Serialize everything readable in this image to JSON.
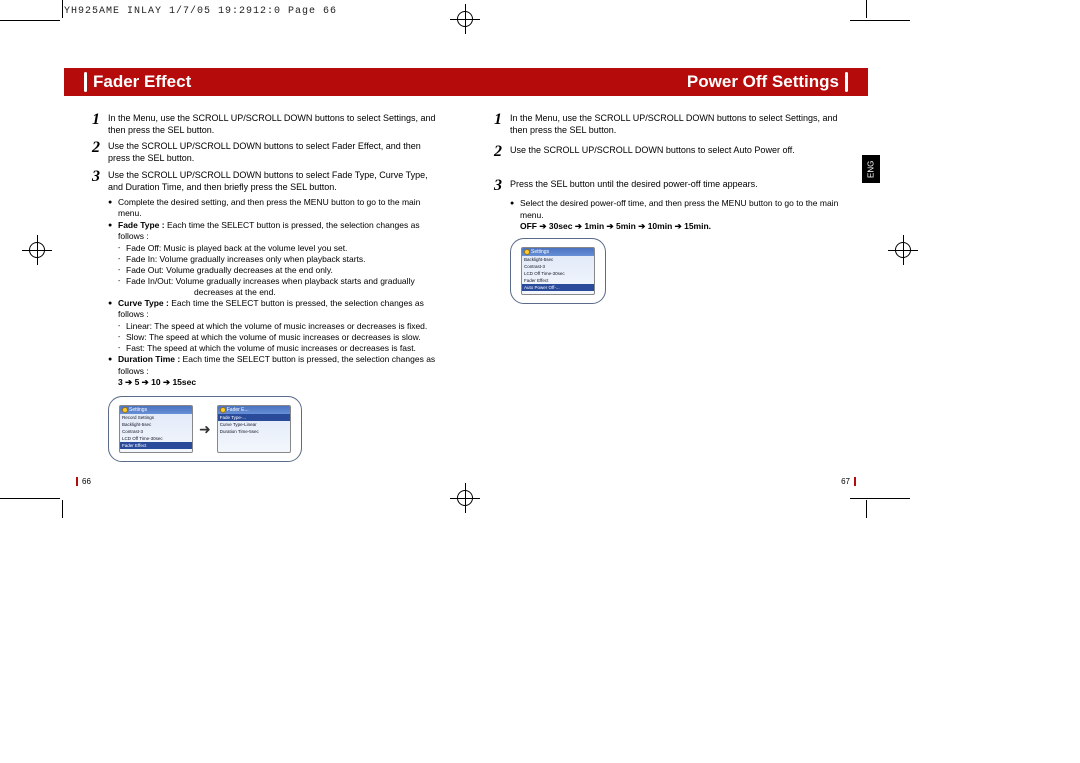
{
  "print_header": "YH925AME INLAY  1/7/05 19:2912:0  Page 66",
  "eng_tab": "ENG",
  "left": {
    "title": "Fader Effect",
    "page_num": "66",
    "steps": [
      {
        "num": "1",
        "text": "In the Menu, use the SCROLL UP/SCROLL DOWN buttons to select Settings, and then press the SEL button."
      },
      {
        "num": "2",
        "text": "Use the SCROLL UP/SCROLL DOWN buttons to select Fader Effect, and then press the SEL button."
      },
      {
        "num": "3",
        "text": "Use the SCROLL UP/SCROLL DOWN buttons to select Fade Type, Curve Type, and Duration Time, and then briefly press the SEL button."
      }
    ],
    "bullets": {
      "complete": "Complete the desired setting, and then press the MENU button to go to the main menu.",
      "fade_type_lead": "Fade Type : ",
      "fade_type_rest": "Each time the SELECT button is pressed, the selection changes as follows :",
      "fade_sub": [
        "Fade Off: Music is played back at the volume level you set.",
        "Fade In: Volume gradually increases only when playback starts.",
        "Fade Out: Volume gradually decreases at the end only.",
        "Fade In/Out: Volume gradually increases when playback starts and gradually"
      ],
      "fade_sub_cont": "decreases at the end.",
      "curve_lead": "Curve Type : ",
      "curve_rest": "Each time the SELECT button is pressed, the selection changes as follows :",
      "curve_sub": [
        "Linear: The speed at which the volume of music increases or decreases is fixed.",
        "Slow: The speed at which the volume of music increases or decreases is slow.",
        "Fast: The speed at which the volume of music increases or decreases is fast."
      ],
      "duration_lead": "Duration Time : ",
      "duration_rest": "Each time the SELECT button is pressed, the selection changes as follows :",
      "duration_seq": "3 ➔ 5 ➔ 10 ➔ 15sec"
    },
    "screens": {
      "settings": {
        "header": "Settings",
        "rows": [
          "Record Settings",
          "Backlight-5sec",
          "Contrast-3",
          "LCD Off Time-30sec"
        ],
        "selected": "Fader Effect"
      },
      "fader": {
        "header": "Fader E...",
        "selected": "Fade Type-...",
        "rows": [
          "Curve Type-Linear",
          "Duration Time-5sec"
        ]
      }
    }
  },
  "right": {
    "title": "Power Off Settings",
    "page_num": "67",
    "steps": [
      {
        "num": "1",
        "text": "In the Menu, use the SCROLL UP/SCROLL DOWN buttons to select Settings, and then press the SEL button."
      },
      {
        "num": "2",
        "text": "Use the SCROLL UP/SCROLL DOWN buttons to select Auto Power off."
      },
      {
        "num": "3",
        "text": "Press the SEL button until the desired power-off time appears."
      }
    ],
    "bullets": {
      "select": "Select the desired power-off time, and then press the MENU button to go to the main menu.",
      "off_seq": "OFF ➔ 30sec ➔ 1min ➔ 5min ➔ 10min ➔ 15min."
    },
    "screens": {
      "settings": {
        "header": "Settings",
        "rows": [
          "Backlight-5sec",
          "Contrast-3",
          "LCD Off Time-30sec",
          "Fader Effect"
        ],
        "selected": "Auto Power Off-..."
      }
    }
  }
}
